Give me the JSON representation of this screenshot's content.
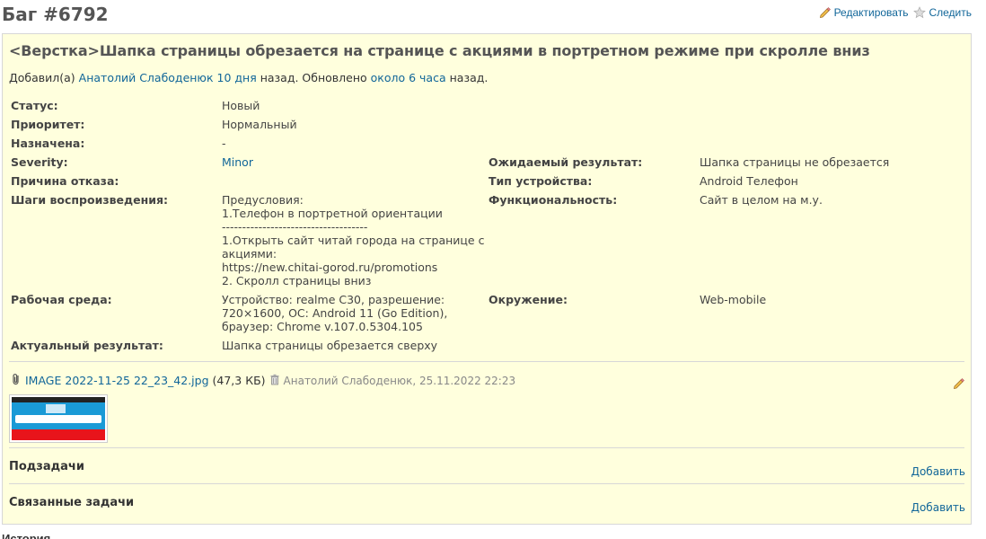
{
  "page": {
    "title": "Баг #6792",
    "edit_label": "Редактировать",
    "watch_label": "Следить"
  },
  "issue": {
    "subject": "<Верстка>Шапка страницы обрезается на странице с акциями в портретном режиме при скролле вниз",
    "author": {
      "prefix": "Добавил(а)",
      "name": "Анатолий Слабоденюк",
      "added_ago": "10 дня",
      "mid": "назад. Обновлено",
      "updated_ago": "около 6 часа",
      "suffix": "назад."
    },
    "left_attributes": [
      {
        "label": "Статус:",
        "value": "Новый"
      },
      {
        "label": "Приоритет:",
        "value": "Нормальный"
      },
      {
        "label": "Назначена:",
        "value": "-"
      },
      {
        "label": "Severity:",
        "value": "Minor"
      },
      {
        "label": "Причина отказа:",
        "value": ""
      },
      {
        "label": "Шаги воспроизведения:",
        "value": "Предусловия:\n1.Телефон в портретной ориентации\n------------------------------------\n1.Открыть сайт читай города на странице с\nакциями:\nhttps://new.chitai-gorod.ru/promotions\n2. Скролл страницы вниз"
      },
      {
        "label": "Рабочая среда:",
        "value": "Устройство: realme C30, разрешение:\n720×1600, ОС: Android 11 (Go Edition),\nбраузер: Chrome v.107.0.5304.105"
      },
      {
        "label": "Актуальный результат:",
        "value": "Шапка страницы обрезается сверху"
      }
    ],
    "right_attributes": [
      {
        "label": "Ожидаемый результат:",
        "value": "Шапка страницы не обрезается"
      },
      {
        "label": "Тип устройства:",
        "value": "Android Телефон"
      },
      {
        "label": "Функциональность:",
        "value": "Сайт в целом на м.у."
      },
      {
        "label": "Окружение:",
        "value": "Web-mobile"
      }
    ],
    "attachment": {
      "filename": "IMAGE 2022-11-25 22_23_42.jpg",
      "size": "(47,3 КБ)",
      "meta": "Анатолий Слабоденюк, 25.11.2022 22:23"
    },
    "subtasks": {
      "title": "Подзадачи",
      "add_label": "Добавить"
    },
    "related": {
      "title": "Связанные задачи",
      "add_label": "Добавить"
    }
  },
  "history_label": "История",
  "colors": {
    "accent_link": "#116699",
    "issue_bg": "#ffffdd",
    "border": "#d7d7d7"
  }
}
